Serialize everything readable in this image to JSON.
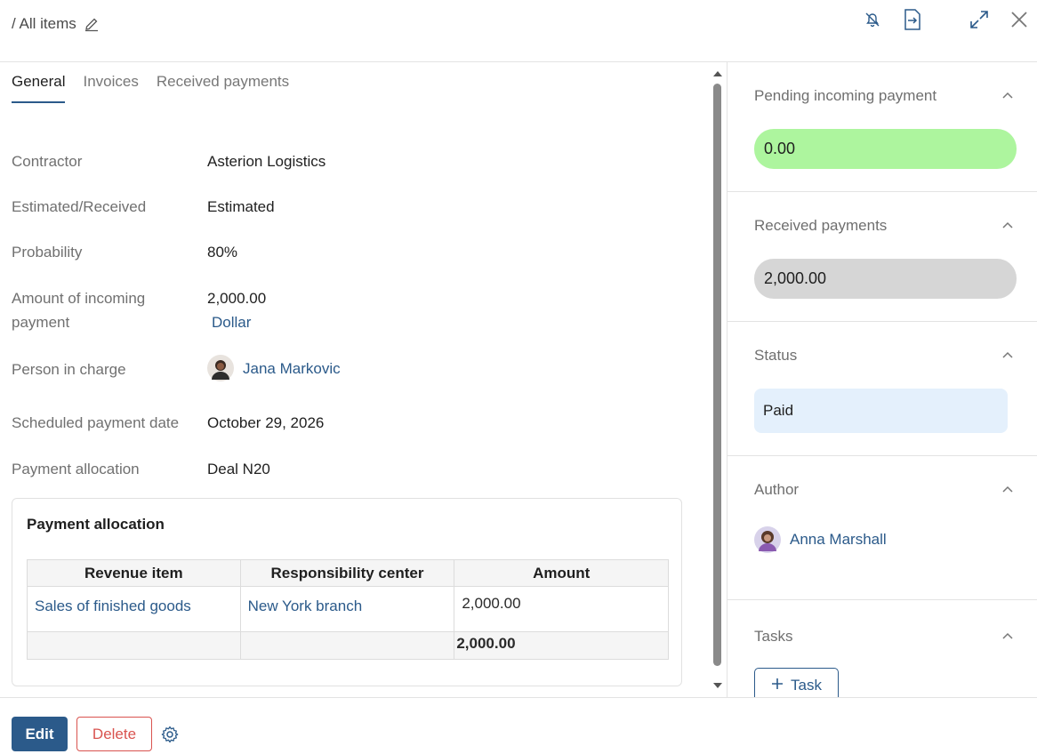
{
  "header": {
    "breadcrumb": "/ All items",
    "icons": [
      "pencil-icon",
      "bell-off-icon",
      "export-icon",
      "expand-icon",
      "close-icon"
    ]
  },
  "tabs": [
    {
      "label": "General",
      "active": true
    },
    {
      "label": "Invoices",
      "active": false
    },
    {
      "label": "Received payments",
      "active": false
    }
  ],
  "fields": {
    "contractor": {
      "label": "Contractor",
      "value": "Asterion Logistics"
    },
    "estimated_received": {
      "label": "Estimated/Received",
      "value": "Estimated"
    },
    "probability": {
      "label": "Probability",
      "value": "80%"
    },
    "amount": {
      "label_line1": "Amount of incoming",
      "label_line2": "payment",
      "value": "2,000.00",
      "currency": "Dollar"
    },
    "person_in_charge": {
      "label": "Person in charge",
      "value": "Jana Markovic"
    },
    "scheduled_date": {
      "label": "Scheduled payment date",
      "value": "October 29, 2026"
    },
    "payment_allocation": {
      "label": "Payment allocation",
      "value": "Deal N20"
    }
  },
  "allocation_table": {
    "title": "Payment allocation",
    "headers": [
      "Revenue item",
      "Responsibility center",
      "Amount"
    ],
    "rows": [
      {
        "revenue_item": "Sales of finished goods",
        "responsibility_center": "New York branch",
        "amount": "2,000.00"
      }
    ],
    "total": "2,000.00"
  },
  "sidebar": {
    "pending": {
      "title": "Pending incoming payment",
      "value": "0.00",
      "color": "#adf59e"
    },
    "received": {
      "title": "Received payments",
      "value": "2,000.00",
      "color": "#d6d6d6"
    },
    "status": {
      "title": "Status",
      "value": "Paid",
      "color": "#e4f0fc"
    },
    "author": {
      "title": "Author",
      "name": "Anna Marshall"
    },
    "tasks": {
      "title": "Tasks",
      "button_label": "Task"
    }
  },
  "footer": {
    "edit_label": "Edit",
    "delete_label": "Delete"
  },
  "colors": {
    "accent": "#2b5a8a",
    "danger": "#d9534f"
  }
}
